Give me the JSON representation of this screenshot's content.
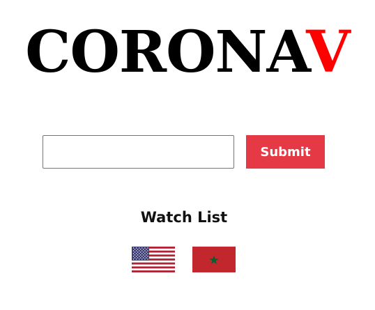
{
  "logo": {
    "main": "CORONA",
    "accent": "V"
  },
  "search": {
    "value": "",
    "submit_label": "Submit"
  },
  "watch_list": {
    "title": "Watch List",
    "flags": [
      {
        "icon": "us-flag-icon"
      },
      {
        "icon": "morocco-flag-icon"
      }
    ]
  },
  "colors": {
    "accent": "#ff0000",
    "button": "#e63946"
  }
}
